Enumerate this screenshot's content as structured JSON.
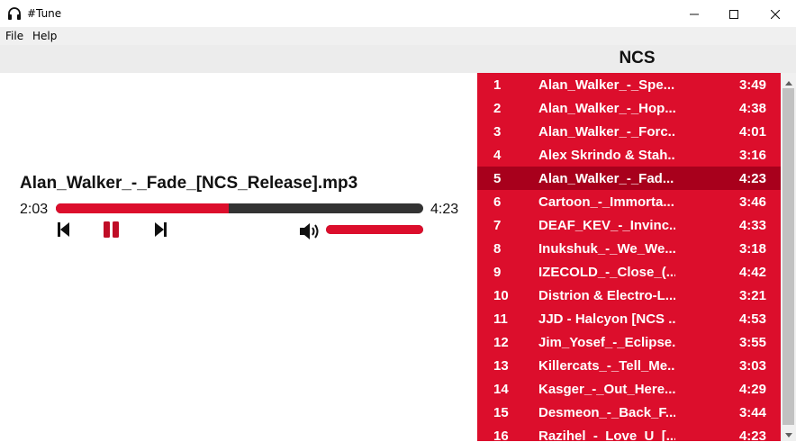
{
  "window": {
    "title": "#Tune",
    "icon": "headphones-icon",
    "controls": [
      "minimize-icon",
      "maximize-icon",
      "close-icon"
    ]
  },
  "menu": {
    "items": [
      "File",
      "Help"
    ]
  },
  "player": {
    "song_title": "Alan_Walker_-_Fade_[NCS_Release].mp3",
    "elapsed": "2:03",
    "total": "4:23",
    "progress_fraction": 0.47,
    "volume_fraction": 1.0,
    "controls": [
      "previous-icon",
      "pause-icon",
      "next-icon",
      "volume-icon"
    ]
  },
  "playlist": {
    "title": "NCS",
    "selected_index": 5,
    "tracks": [
      {
        "num": "1",
        "name": "Alan_Walker_-_Spe...",
        "duration": "3:49"
      },
      {
        "num": "2",
        "name": "Alan_Walker_-_Hop...",
        "duration": "4:38"
      },
      {
        "num": "3",
        "name": "Alan_Walker_-_Forc...",
        "duration": "4:01"
      },
      {
        "num": "4",
        "name": "Alex Skrindo & Stah...",
        "duration": "3:16"
      },
      {
        "num": "5",
        "name": "Alan_Walker_-_Fad...",
        "duration": "4:23"
      },
      {
        "num": "6",
        "name": "Cartoon_-_Immorta...",
        "duration": "3:46"
      },
      {
        "num": "7",
        "name": "DEAF_KEV_-_Invinc...",
        "duration": "4:33"
      },
      {
        "num": "8",
        "name": "Inukshuk_-_We_We...",
        "duration": "3:18"
      },
      {
        "num": "9",
        "name": "IZECOLD_-_Close_(...",
        "duration": "4:42"
      },
      {
        "num": "10",
        "name": "Distrion & Electro-L...",
        "duration": "3:21"
      },
      {
        "num": "11",
        "name": "JJD - Halcyon [NCS ...",
        "duration": "4:53"
      },
      {
        "num": "12",
        "name": "Jim_Yosef_-_Eclipse...",
        "duration": "3:55"
      },
      {
        "num": "13",
        "name": "Killercats_-_Tell_Me...",
        "duration": "3:03"
      },
      {
        "num": "14",
        "name": "Kasger_-_Out_Here...",
        "duration": "4:29"
      },
      {
        "num": "15",
        "name": "Desmeon_-_Back_F...",
        "duration": "3:44"
      },
      {
        "num": "16",
        "name": "Razihel_-_Love_U_[...",
        "duration": "4:23"
      }
    ]
  },
  "colors": {
    "accent": "#dc0e2c",
    "selected_row": "#a8001c",
    "track_dark": "#333333"
  }
}
